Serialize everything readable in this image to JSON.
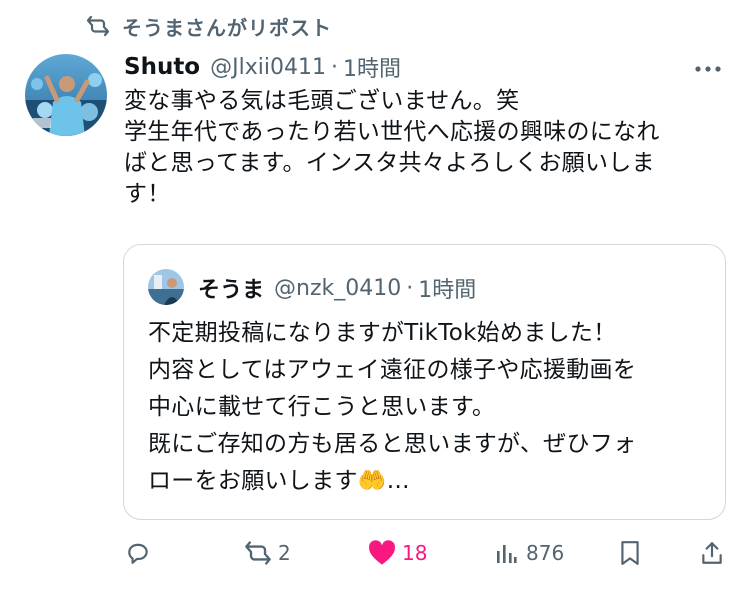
{
  "repost_banner": {
    "text": "そうまさんがリポスト",
    "icon": "repost-icon"
  },
  "tweet": {
    "author_name": "Shuto",
    "author_handle": "@Jlxii0411",
    "separator": "·",
    "time": "1時間",
    "more_icon": "more-icon",
    "text": "変な事やる気は毛頭ございません。笑\n学生年代であったり若い世代へ応援の興味のになれ\nばと思ってます。インスタ共々よろしくお願いしま\nす！"
  },
  "quote": {
    "author_name": "そうま",
    "author_handle": "@nzk_0410",
    "separator": "·",
    "time": "1時間",
    "text": "不定期投稿になりますがTikTok始めました！\n内容としてはアウェイ遠征の様子や応援動画を\n中心に載せて行こうと思います。\n既にご存知の方も居ると思いますが、ぜひフォ\nローをお願いします🤲…"
  },
  "actions": {
    "reply": {
      "icon": "reply-icon",
      "count": ""
    },
    "repost": {
      "icon": "repost-icon",
      "count": "2"
    },
    "like": {
      "icon": "heart-filled-icon",
      "count": "18"
    },
    "views": {
      "icon": "bar-chart-icon",
      "count": "876"
    },
    "bookmark": {
      "icon": "bookmark-icon"
    },
    "share": {
      "icon": "share-icon"
    }
  },
  "colors": {
    "text_primary": "#0f1419",
    "text_secondary": "#536471",
    "like_pink": "#f91880",
    "border": "#cfd9de"
  }
}
